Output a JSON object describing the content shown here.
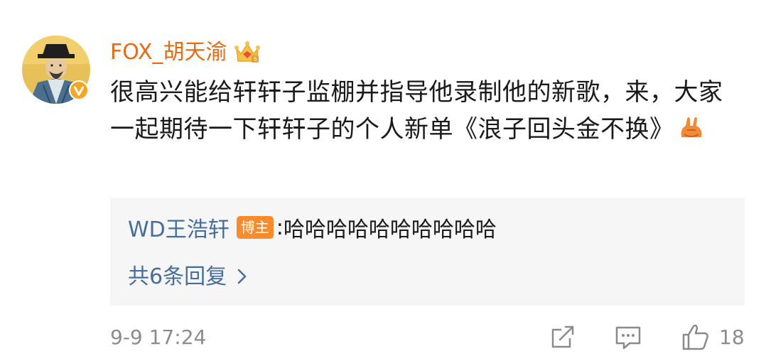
{
  "comment": {
    "username": "FOX_胡天渝",
    "text": "很高兴能给轩轩子监棚并指导他录制他的新歌，来，大家一起期待一下轩轩子的个人新单《浪子回头金不换》",
    "timestamp": "9-9 17:24",
    "like_count": "18"
  },
  "reply": {
    "username": "WD王浩轩",
    "badge": "博主",
    "colon": ":",
    "text": "哈哈哈哈哈哈哈哈哈哈",
    "more_label": "共6条回复"
  },
  "icons": {
    "avatar": "avatar-portrait",
    "verified": "verified-badge-icon",
    "crown": "crown-icon",
    "emoji": "victory-hands-emoji",
    "more": "chevron-right-icon",
    "share": "share-icon",
    "comment": "comment-icon",
    "like": "thumbs-up-icon"
  },
  "colors": {
    "username": "#ea6a0f",
    "link": "#466d9e",
    "badge_bg": "#f98b2b",
    "reply_bg": "#f6f6f6",
    "meta": "#8c8c8c"
  }
}
